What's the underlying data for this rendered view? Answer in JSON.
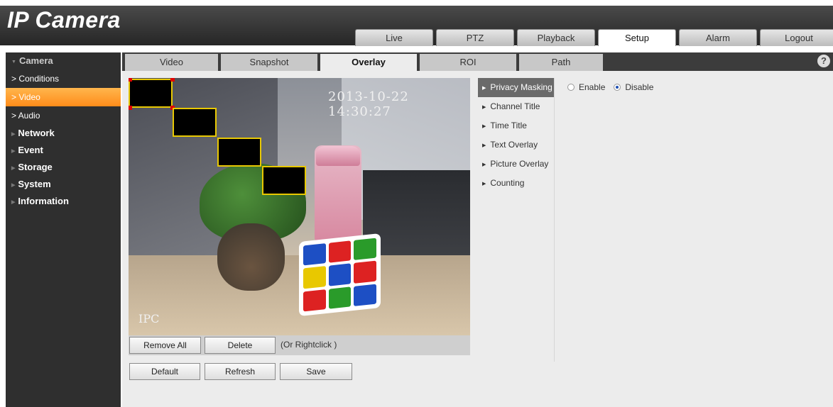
{
  "app": {
    "title": "IP Camera"
  },
  "nav": {
    "tabs": [
      {
        "label": "Live"
      },
      {
        "label": "PTZ"
      },
      {
        "label": "Playback"
      },
      {
        "label": "Setup",
        "active": true
      },
      {
        "label": "Alarm"
      },
      {
        "label": "Logout"
      }
    ]
  },
  "sidebar": {
    "camera": {
      "label": "Camera",
      "open": true
    },
    "camera_items": [
      {
        "label": "> Conditions"
      },
      {
        "label": "> Video",
        "active": true
      },
      {
        "label": "> Audio"
      }
    ],
    "groups": [
      {
        "label": "Network"
      },
      {
        "label": "Event"
      },
      {
        "label": "Storage"
      },
      {
        "label": "System"
      },
      {
        "label": "Information"
      }
    ]
  },
  "subtabs": {
    "tabs": [
      {
        "label": "Video"
      },
      {
        "label": "Snapshot"
      },
      {
        "label": "Overlay",
        "active": true
      },
      {
        "label": "ROI"
      },
      {
        "label": "Path"
      }
    ],
    "help_label": "?"
  },
  "video": {
    "timestamp": "2013-10-22 14:30:27",
    "channel_name": "IPC",
    "privacy_masks_count": 4
  },
  "toolbar": {
    "remove_all_label": "Remove All",
    "delete_label": "Delete",
    "hint": "(Or Rightclick )"
  },
  "actions": {
    "default_label": "Default",
    "refresh_label": "Refresh",
    "save_label": "Save"
  },
  "overlay_menu": {
    "items": [
      {
        "label": "Privacy Masking",
        "active": true
      },
      {
        "label": "Channel Title"
      },
      {
        "label": "Time Title"
      },
      {
        "label": "Text Overlay"
      },
      {
        "label": "Picture Overlay"
      },
      {
        "label": "Counting"
      }
    ]
  },
  "privacy": {
    "enable_label": "Enable",
    "disable_label": "Disable",
    "selected": "Disable"
  },
  "colors": {
    "accent_orange": "#ff8c1a",
    "mask_border": "#e8c800",
    "handle_red": "#e00000"
  }
}
